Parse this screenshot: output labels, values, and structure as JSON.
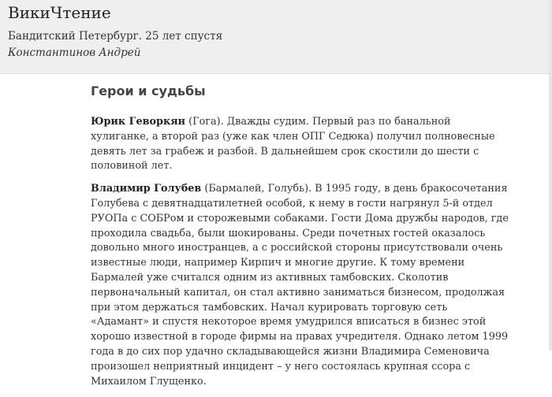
{
  "header": {
    "site_title": "ВикиЧтение",
    "book_title": "Бандитский Петербург. 25 лет спустя",
    "book_author": "Константинов Андрей"
  },
  "content": {
    "section_title": "Герои и судьбы",
    "paragraphs": [
      {
        "name": "Юрик Геворкян",
        "text": " (Гога). Дважды судим. Первый раз по банальной хулиганке, а второй раз (уже как член ОПГ Седюка) получил полновесные девять лет за грабеж и разбой. В дальнейшем срок скостили до шести с половиной лет."
      },
      {
        "name": "Владимир Голубев",
        "text": " (Бармалей, Голубь). В 1995 году, в день бракосочетания Голубева с девятнадцатилетней особой, к нему в гости нагрянул 5-й отдел РУОПа с СОБРом и сторожевыми собаками. Гости Дома дружбы народов, где проходила свадьба, были шокированы. Среди почетных гостей оказалось довольно много иностранцев, а с российской стороны присутствовали очень известные люди, например Кирпич и многие другие. К тому времени Бармалей уже считался одним из активных тамбовских. Сколотив первоначальный капитал, он стал активно заниматься бизнесом, продолжая при этом держаться тамбовских. Начал курировать торговую сеть «Адамант» и спустя некоторое время умудрился вписаться в бизнес этой хорошо известной в городе фирмы на правах учредителя. Однако летом 1999 года в до сих пор удачно складывающейся жизни Владимира Семеновича произошел неприятный инцидент – у него состоялась крупная ссора с Михаилом Глущенко."
      }
    ]
  }
}
